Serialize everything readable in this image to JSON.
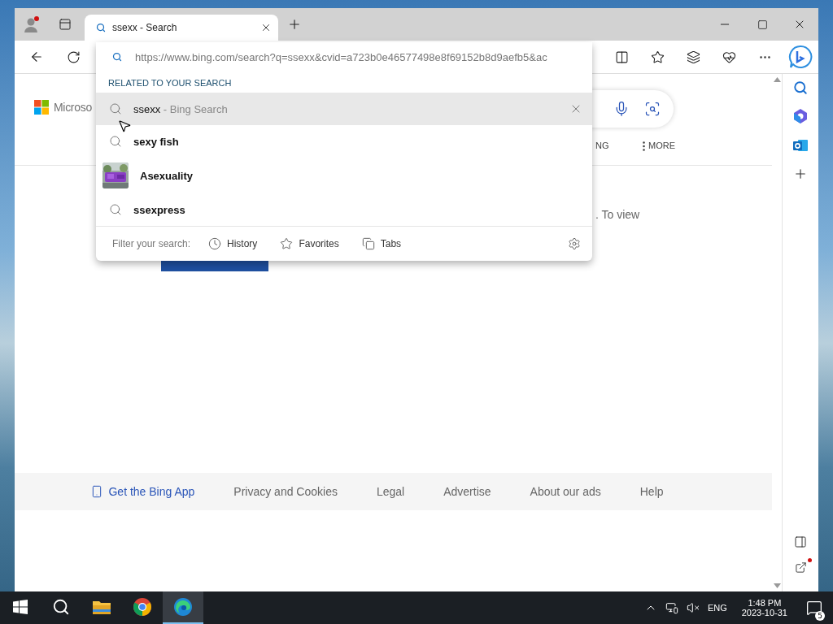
{
  "browser": {
    "tabs": [
      {
        "title": "ssexx - Search",
        "selected": true
      }
    ],
    "address": {
      "url": "https://www.bing.com/search?q=ssexx&cvid=a723b0e46577498e8f69152b8d9aefb5&ac"
    },
    "suggestions": {
      "heading": "RELATED TO YOUR SEARCH",
      "items": [
        {
          "kind": "query",
          "text": "ssexx",
          "suffix": " - Bing Search",
          "selected": true
        },
        {
          "kind": "search",
          "text": "sexy fish",
          "selected": false
        },
        {
          "kind": "entity",
          "text": "Asexuality",
          "selected": false
        },
        {
          "kind": "search",
          "text": "ssexpress",
          "selected": false
        }
      ],
      "filter_label": "Filter your search:",
      "filters": [
        {
          "kind": "history",
          "label": "History"
        },
        {
          "kind": "favorites",
          "label": "Favorites"
        },
        {
          "kind": "tabs",
          "label": "Tabs"
        }
      ]
    }
  },
  "page": {
    "logo_text": "Microso",
    "nav_partial": "NG",
    "more": "MORE",
    "message_partial": ". To view",
    "footer": [
      {
        "kind": "app",
        "label": "Get the Bing App"
      },
      {
        "kind": "link",
        "label": "Privacy and Cookies"
      },
      {
        "kind": "link",
        "label": "Legal"
      },
      {
        "kind": "link",
        "label": "Advertise"
      },
      {
        "kind": "link",
        "label": "About our ads"
      },
      {
        "kind": "link",
        "label": "Help"
      }
    ]
  },
  "taskbar": {
    "apps": [
      {
        "kind": "explorer",
        "selected": false
      },
      {
        "kind": "chrome",
        "selected": false
      },
      {
        "kind": "edge",
        "selected": true
      }
    ],
    "language": "ENG",
    "time": "1:48 PM",
    "date": "2023-10-31",
    "notifications": "5"
  }
}
